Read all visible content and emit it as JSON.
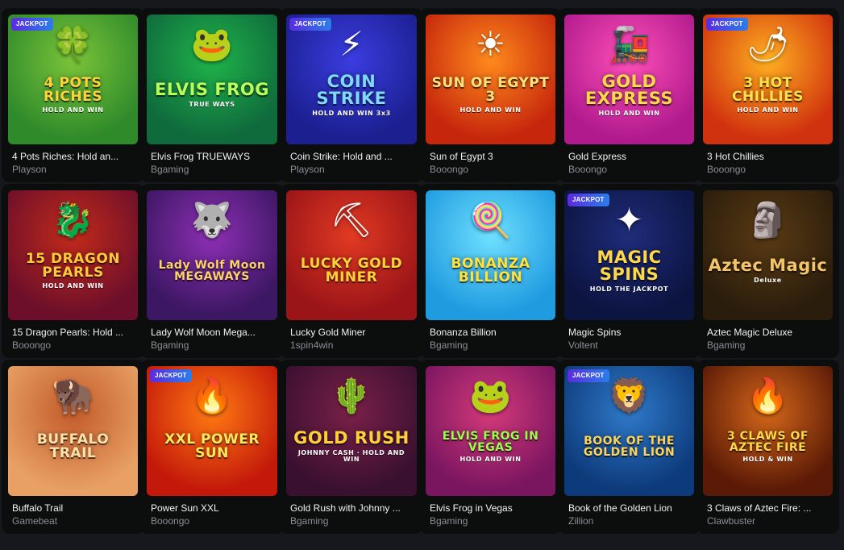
{
  "badge_label": "JACKPOT",
  "games": [
    {
      "name": "4 Pots Riches: Hold an...",
      "provider": "Playson",
      "art_title": "4 POTS RICHES",
      "art_sub": "HOLD AND WIN",
      "jackpot": true,
      "icon": "leprechaun-icon",
      "colors": [
        "#2f8a2a",
        "#7ac43a"
      ],
      "title_color": "#ffd23a"
    },
    {
      "name": "Elvis Frog TRUEWAYS",
      "provider": "Bgaming",
      "art_title": "ELVIS FROG",
      "art_sub": "TRUE WAYS",
      "jackpot": false,
      "icon": "frog-icon",
      "colors": [
        "#0f6a3c",
        "#1fb34a"
      ],
      "title_color": "#b8ff5a"
    },
    {
      "name": "Coin Strike: Hold and ...",
      "provider": "Playson",
      "art_title": "COIN STRIKE",
      "art_sub": "HOLD AND WIN 3x3",
      "jackpot": true,
      "icon": "lightning-coin-icon",
      "colors": [
        "#1b1f8f",
        "#3a3de0"
      ],
      "title_color": "#7fd8ff"
    },
    {
      "name": "Sun of Egypt 3",
      "provider": "Booongo",
      "art_title": "SUN OF EGYPT 3",
      "art_sub": "HOLD AND WIN",
      "jackpot": false,
      "icon": "sun-icon",
      "colors": [
        "#c6260c",
        "#ff8a1c"
      ],
      "title_color": "#ffe27a"
    },
    {
      "name": "Gold Express",
      "provider": "Booongo",
      "art_title": "GOLD EXPRESS",
      "art_sub": "HOLD AND WIN",
      "jackpot": false,
      "icon": "train-icon",
      "colors": [
        "#b01a8d",
        "#ff4fb8"
      ],
      "title_color": "#ffd84a"
    },
    {
      "name": "3 Hot Chillies",
      "provider": "Booongo",
      "art_title": "3 HOT CHILLIES",
      "art_sub": "HOLD AND WIN",
      "jackpot": true,
      "icon": "sombrero-icon",
      "colors": [
        "#d0310e",
        "#ffb020"
      ],
      "title_color": "#ffe14a"
    },
    {
      "name": "15 Dragon Pearls: Hold ...",
      "provider": "Booongo",
      "art_title": "15 DRAGON PEARLS",
      "art_sub": "HOLD AND WIN",
      "jackpot": false,
      "icon": "dragon-icon",
      "colors": [
        "#6d0f2a",
        "#c22a1a"
      ],
      "title_color": "#ffc93a"
    },
    {
      "name": "Lady Wolf Moon Mega...",
      "provider": "Bgaming",
      "art_title": "Lady Wolf Moon MEGAWAYS",
      "art_sub": "",
      "jackpot": false,
      "icon": "wolf-icon",
      "colors": [
        "#3c1763",
        "#8e2fb5"
      ],
      "title_color": "#ffd36a"
    },
    {
      "name": "Lucky Gold Miner",
      "provider": "1spin4win",
      "art_title": "LUCKY GOLD MINER",
      "art_sub": "",
      "jackpot": false,
      "icon": "miner-icon",
      "colors": [
        "#9a1418",
        "#e23a22"
      ],
      "title_color": "#ffd23a"
    },
    {
      "name": "Bonanza Billion",
      "provider": "Bgaming",
      "art_title": "BONANZA BILLION",
      "art_sub": "",
      "jackpot": false,
      "icon": "candy-icon",
      "colors": [
        "#1f9be0",
        "#6fe0ff"
      ],
      "title_color": "#ffe23a"
    },
    {
      "name": "Magic Spins",
      "provider": "Voltent",
      "art_title": "MAGIC SPINS",
      "art_sub": "HOLD THE JACKPOT",
      "jackpot": true,
      "icon": "star-icon",
      "colors": [
        "#0c1440",
        "#1f2c7a"
      ],
      "title_color": "#ffd84a"
    },
    {
      "name": "Aztec Magic Deluxe",
      "provider": "Bgaming",
      "art_title": "Aztec Magic",
      "art_sub": "Deluxe",
      "jackpot": false,
      "icon": "aztec-warrior-icon",
      "colors": [
        "#2a1d0c",
        "#5a3a14"
      ],
      "title_color": "#f3c46a"
    },
    {
      "name": "Buffalo Trail",
      "provider": "Gamebeat",
      "art_title": "BUFFALO TRAIL",
      "art_sub": "",
      "jackpot": false,
      "icon": "buffalo-icon",
      "colors": [
        "#e8a064",
        "#c25a2a"
      ],
      "title_color": "#ffe2a8"
    },
    {
      "name": "Power Sun XXL",
      "provider": "Booongo",
      "art_title": "XXL POWER SUN",
      "art_sub": "",
      "jackpot": true,
      "icon": "fire-icon",
      "colors": [
        "#c3180a",
        "#ff7a12"
      ],
      "title_color": "#ffe95a"
    },
    {
      "name": "Gold Rush with Johnny ...",
      "provider": "Bgaming",
      "art_title": "GOLD RUSH",
      "art_sub": "JOHNNY CASH · HOLD AND WIN",
      "jackpot": false,
      "icon": "cactus-icon",
      "colors": [
        "#3a1030",
        "#7a2048"
      ],
      "title_color": "#ffcf3a"
    },
    {
      "name": "Elvis Frog in Vegas",
      "provider": "Bgaming",
      "art_title": "ELVIS FROG IN VEGAS",
      "art_sub": "HOLD AND WIN",
      "jackpot": false,
      "icon": "frog-icon",
      "colors": [
        "#7a1560",
        "#d43a7a"
      ],
      "title_color": "#9bff4a"
    },
    {
      "name": "Book of the Golden Lion",
      "provider": "Zillion",
      "art_title": "BOOK OF THE GOLDEN LION",
      "art_sub": "",
      "jackpot": true,
      "icon": "lion-icon",
      "colors": [
        "#0d3a7a",
        "#2f7ac9"
      ],
      "title_color": "#ffd45a"
    },
    {
      "name": "3 Claws of Aztec Fire: ...",
      "provider": "Clawbuster",
      "art_title": "3 CLAWS OF AZTEC FIRE",
      "art_sub": "HOLD & WIN",
      "jackpot": false,
      "icon": "warrior-icon",
      "colors": [
        "#5a1a06",
        "#d4661a"
      ],
      "title_color": "#ffd84a"
    }
  ]
}
